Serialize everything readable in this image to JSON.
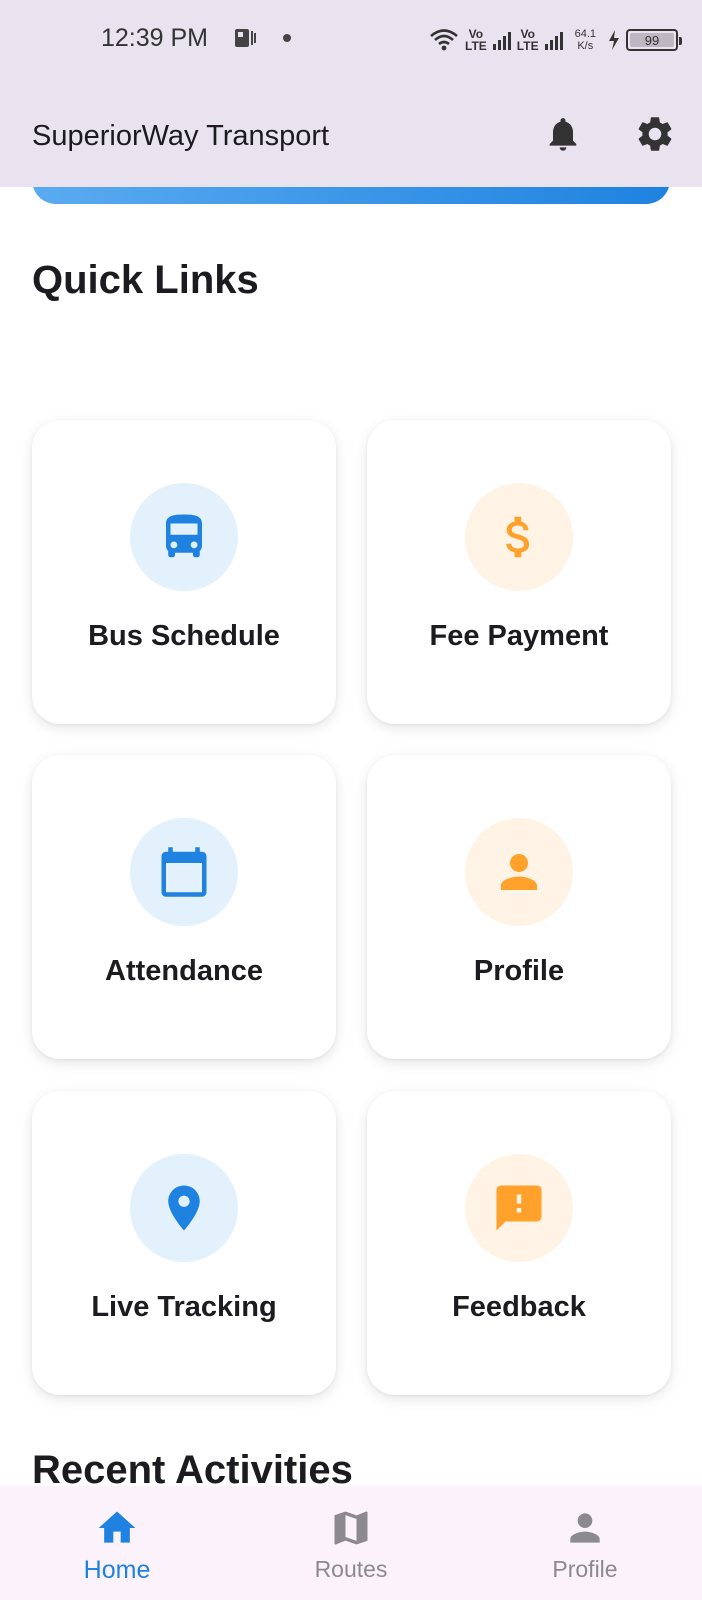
{
  "status_bar": {
    "time": "12:39 PM",
    "volte_1_top": "Vo",
    "volte_1_bottom": "LTE",
    "volte_2_top": "Vo",
    "volte_2_bottom": "LTE",
    "speed_value": "64.1",
    "speed_unit": "K/s",
    "battery": "99"
  },
  "app_bar": {
    "title": "SuperiorWay Transport",
    "icons": [
      "bell-icon",
      "gear-icon"
    ]
  },
  "quick_links": {
    "title": "Quick Links",
    "items": [
      {
        "label": "Bus Schedule",
        "icon": "bus-icon",
        "color": "#1f82e0"
      },
      {
        "label": "Fee Payment",
        "icon": "dollar-icon",
        "color": "#ffa12b"
      },
      {
        "label": "Attendance",
        "icon": "calendar-icon",
        "color": "#1f82e0"
      },
      {
        "label": "Profile",
        "icon": "person-icon",
        "color": "#ffa12b"
      },
      {
        "label": "Live Tracking",
        "icon": "location-pin-icon",
        "color": "#1f82e0"
      },
      {
        "label": "Feedback",
        "icon": "feedback-icon",
        "color": "#ffa12b"
      }
    ]
  },
  "recent_activities": {
    "title": "Recent Activities"
  },
  "bottom_nav": {
    "active_color": "#1f82e0",
    "inactive_color": "#8c8990",
    "items": [
      {
        "label": "Home",
        "icon": "home-icon",
        "active": true
      },
      {
        "label": "Routes",
        "icon": "map-icon",
        "active": false
      },
      {
        "label": "Profile",
        "icon": "person-icon",
        "active": false
      }
    ]
  }
}
